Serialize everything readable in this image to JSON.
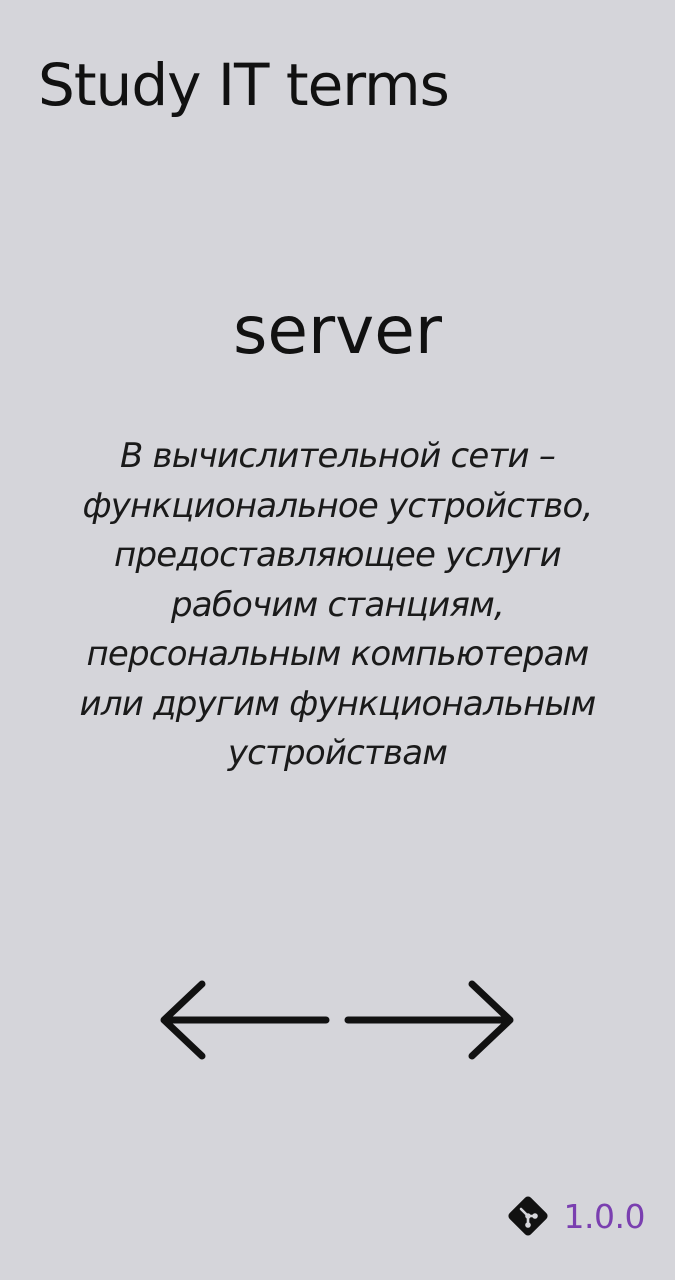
{
  "app": {
    "title": "Study IT terms"
  },
  "card": {
    "term": "server",
    "definition": "В вычислительной сети – функциональное устройство, предоставляющее услуги рабочим станциям, персональным компьютерам или другим функциональным устройствам"
  },
  "navigation": {
    "prev_icon": "arrow-left-icon",
    "next_icon": "arrow-right-icon"
  },
  "footer": {
    "icon": "git-icon",
    "version": "1.0.0"
  },
  "colors": {
    "background": "#d5d5da",
    "text": "#111111",
    "version_accent": "#7a3fb0"
  }
}
